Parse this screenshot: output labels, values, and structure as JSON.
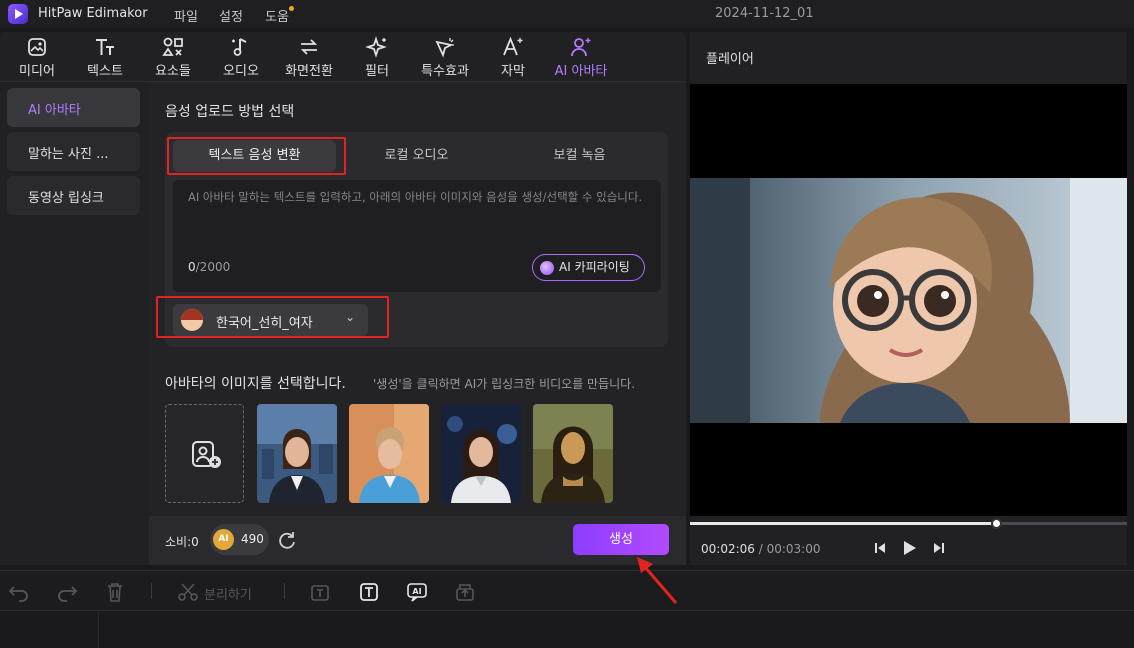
{
  "app": {
    "name": "HitPaw Edimakor",
    "document_title": "2024-11-12_01"
  },
  "menu": [
    {
      "label": "파일"
    },
    {
      "label": "설정"
    },
    {
      "label": "도움"
    }
  ],
  "toolbar": [
    {
      "label": "미디어",
      "icon": "media-icon"
    },
    {
      "label": "텍스트",
      "icon": "text-icon"
    },
    {
      "label": "요소들",
      "icon": "elements-icon"
    },
    {
      "label": "오디오",
      "icon": "audio-icon"
    },
    {
      "label": "화면전환",
      "icon": "transition-icon"
    },
    {
      "label": "필터",
      "icon": "filter-icon"
    },
    {
      "label": "특수효과",
      "icon": "effects-icon"
    },
    {
      "label": "자막",
      "icon": "subtitle-icon"
    },
    {
      "label": "AI 아바타",
      "icon": "ai-avatar-icon",
      "active": true
    }
  ],
  "sidebar": [
    {
      "label": "AI 아바타",
      "active": true
    },
    {
      "label": "말하는 사진 ..."
    },
    {
      "label": "동영상 립싱크"
    }
  ],
  "upload": {
    "title": "음성 업로드 방법 선택",
    "tabs": [
      {
        "label": "텍스트 음성 변환",
        "active": true
      },
      {
        "label": "로컬 오디오"
      },
      {
        "label": "보컬 녹음"
      }
    ],
    "placeholder": "AI 아바타 말하는 텍스트를 입력하고, 아래의 아바타 이미지와 음성을 생성/선택할 수 있습니다.",
    "count_current": "0",
    "count_max": "/2000",
    "ai_copywriting_label": "AI 카피라이팅",
    "voice_label": "한국어_선히_여자"
  },
  "images": {
    "title": "아바타의 이미지를 선택합니다.",
    "hint": "'생성'을 클릭하면 AI가 립싱크한 비디오를 만듭니다.",
    "thumbnails": [
      {
        "icon": "avatar-woman-newsroom"
      },
      {
        "icon": "avatar-woman-blue-blazer"
      },
      {
        "icon": "avatar-woman-white-blazer"
      },
      {
        "icon": "avatar-mona-lisa"
      }
    ]
  },
  "footer": {
    "cost_label": "소비:0",
    "coin_label": "AI",
    "credits": "490",
    "generate_label": "생성"
  },
  "player": {
    "title": "플레이어",
    "current_time": "00:02:06",
    "separator": " / ",
    "total_time": "00:03:00",
    "progress": 0.7
  },
  "timeline_toolbar": {
    "split_label": "분리하기"
  },
  "colors": {
    "accent": "#a855f7",
    "highlight_box": "#e32222",
    "background": "#1a1a1d"
  }
}
